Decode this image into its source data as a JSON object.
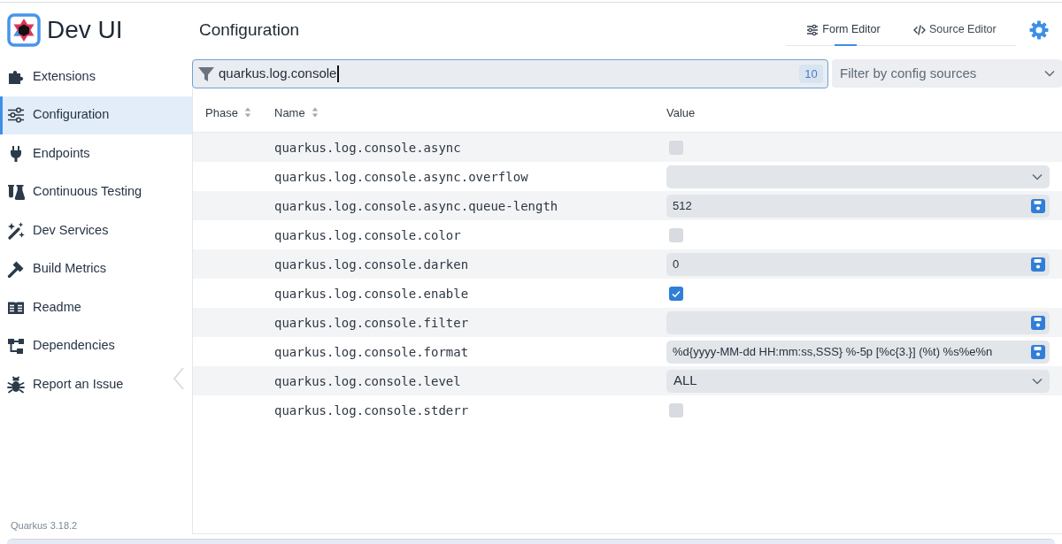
{
  "app": {
    "title": "Dev UI",
    "version": "Quarkus 3.18.2"
  },
  "sidebar": {
    "items": [
      {
        "label": "Extensions",
        "selected": false
      },
      {
        "label": "Configuration",
        "selected": true
      },
      {
        "label": "Endpoints",
        "selected": false
      },
      {
        "label": "Continuous Testing",
        "selected": false
      },
      {
        "label": "Dev Services",
        "selected": false
      },
      {
        "label": "Build Metrics",
        "selected": false
      },
      {
        "label": "Readme",
        "selected": false
      },
      {
        "label": "Dependencies",
        "selected": false
      },
      {
        "label": "Report an Issue",
        "selected": false
      }
    ]
  },
  "page": {
    "title": "Configuration",
    "tabs": [
      {
        "label": "Form Editor",
        "selected": true
      },
      {
        "label": "Source Editor",
        "selected": false
      }
    ]
  },
  "search": {
    "value": "quarkus.log.console",
    "count": "10"
  },
  "source_filter": {
    "placeholder": "Filter by config sources"
  },
  "table": {
    "columns": [
      {
        "label": "Phase",
        "sortable": true
      },
      {
        "label": "Name",
        "sortable": true
      },
      {
        "label": "Value",
        "sortable": false
      }
    ],
    "rows": [
      {
        "name": "quarkus.log.console.async",
        "kind": "checkbox",
        "checked": false
      },
      {
        "name": "quarkus.log.console.async.overflow",
        "kind": "select"
      },
      {
        "name": "quarkus.log.console.async.queue-length",
        "kind": "text",
        "value": "512"
      },
      {
        "name": "quarkus.log.console.color",
        "kind": "checkbox",
        "checked": false
      },
      {
        "name": "quarkus.log.console.darken",
        "kind": "text",
        "value": "0"
      },
      {
        "name": "quarkus.log.console.enable",
        "kind": "checkbox",
        "checked": true
      },
      {
        "name": "quarkus.log.console.filter",
        "kind": "text"
      },
      {
        "name": "quarkus.log.console.format",
        "kind": "text",
        "value": "%d{yyyy-MM-dd HH:mm:ss,SSS} %-5p [%c{3.}] (%t) %s%e%n"
      },
      {
        "name": "quarkus.log.console.level",
        "kind": "select",
        "value": "ALL"
      },
      {
        "name": "quarkus.log.console.stderr",
        "kind": "checkbox",
        "checked": false
      }
    ]
  }
}
